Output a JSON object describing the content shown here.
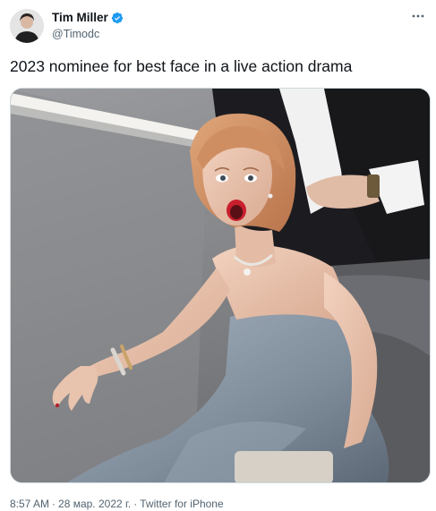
{
  "author": {
    "display_name": "Tim Miller",
    "handle": "@Timodc",
    "verified": true
  },
  "tweet": {
    "text": "2023 nominee for best face in a live action drama"
  },
  "meta": {
    "time": "8:57 AM",
    "date": "28 мар. 2022 г.",
    "source": "Twitter for iPhone",
    "separator": "·"
  },
  "icons": {
    "verified": "verified-badge-icon",
    "more": "more-options-icon"
  },
  "colors": {
    "text": "#0f1419",
    "secondary": "#536471",
    "verified": "#1d9bf0"
  }
}
